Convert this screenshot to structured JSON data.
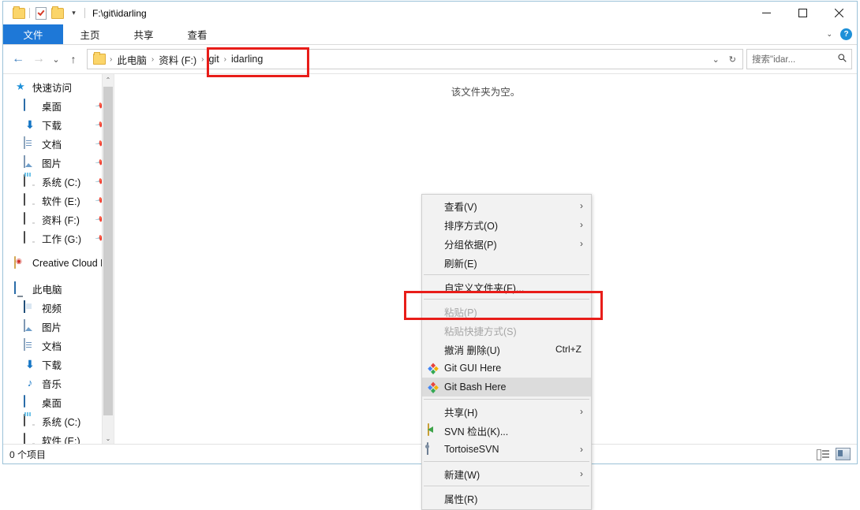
{
  "window": {
    "title": "F:\\git\\idarling",
    "quick_access": [
      {
        "name": "folder-icon",
        "label": ""
      },
      {
        "name": "properties-icon",
        "label": ""
      },
      {
        "name": "new-folder-icon",
        "label": ""
      },
      {
        "name": "customize-qat-chevron",
        "label": "▾"
      }
    ],
    "controls": {
      "minimize": "—",
      "maximize": "□",
      "close": "✕"
    }
  },
  "ribbon": {
    "tabs": [
      {
        "label": "文件",
        "active": true
      },
      {
        "label": "主页",
        "active": false
      },
      {
        "label": "共享",
        "active": false
      },
      {
        "label": "查看",
        "active": false
      }
    ],
    "collapse_chevron": "⌄",
    "help_label": "?"
  },
  "navigation": {
    "back": "←",
    "forward": "→",
    "recent": "⌄",
    "up": "↑",
    "breadcrumb": [
      {
        "label": "此电脑"
      },
      {
        "label": "资料 (F:)"
      },
      {
        "label": "git"
      },
      {
        "label": "idarling"
      }
    ],
    "separator": "›",
    "dropdown": "⌄",
    "refresh": "↻"
  },
  "search": {
    "placeholder": "搜索\"idar...",
    "icon": "search-icon"
  },
  "sidebar": {
    "groups": [
      {
        "header": {
          "label": "快速访问",
          "icon": "star-icon"
        },
        "items": [
          {
            "label": "桌面",
            "icon": "desktop-icon",
            "pinned": true
          },
          {
            "label": "下载",
            "icon": "download-icon",
            "pinned": true
          },
          {
            "label": "文档",
            "icon": "documents-icon",
            "pinned": true
          },
          {
            "label": "图片",
            "icon": "pictures-icon",
            "pinned": true
          },
          {
            "label": "系统 (C:)",
            "icon": "system-drive-icon",
            "pinned": true
          },
          {
            "label": "软件 (E:)",
            "icon": "drive-icon",
            "pinned": true
          },
          {
            "label": "资料 (F:)",
            "icon": "drive-icon",
            "pinned": true
          },
          {
            "label": "工作 (G:)",
            "icon": "drive-icon",
            "pinned": true
          }
        ]
      },
      {
        "header": {
          "label": "Creative Cloud F",
          "icon": "creative-cloud-icon"
        },
        "items": []
      },
      {
        "header": {
          "label": "此电脑",
          "icon": "this-pc-icon"
        },
        "items": [
          {
            "label": "视频",
            "icon": "videos-icon",
            "pinned": false
          },
          {
            "label": "图片",
            "icon": "pictures-icon",
            "pinned": false
          },
          {
            "label": "文档",
            "icon": "documents-icon",
            "pinned": false
          },
          {
            "label": "下载",
            "icon": "download-icon",
            "pinned": false
          },
          {
            "label": "音乐",
            "icon": "music-icon",
            "pinned": false
          },
          {
            "label": "桌面",
            "icon": "desktop-icon",
            "pinned": false
          },
          {
            "label": "系统 (C:)",
            "icon": "system-drive-icon",
            "pinned": false
          },
          {
            "label": "软件 (E:)",
            "icon": "drive-icon",
            "pinned": false
          }
        ]
      }
    ],
    "scroll_up": "⌃",
    "scroll_down": "⌄"
  },
  "content": {
    "empty_message": "该文件夹为空。"
  },
  "context_menu": {
    "items": [
      {
        "label": "查看(V)",
        "icon": null,
        "submenu": true,
        "accel": "",
        "disabled": false,
        "highlighted": false
      },
      {
        "label": "排序方式(O)",
        "icon": null,
        "submenu": true,
        "accel": "",
        "disabled": false,
        "highlighted": false
      },
      {
        "label": "分组依据(P)",
        "icon": null,
        "submenu": true,
        "accel": "",
        "disabled": false,
        "highlighted": false
      },
      {
        "label": "刷新(E)",
        "icon": null,
        "submenu": false,
        "accel": "",
        "disabled": false,
        "highlighted": false
      },
      {
        "separator": true
      },
      {
        "label": "自定义文件夹(F)...",
        "icon": null,
        "submenu": false,
        "accel": "",
        "disabled": false,
        "highlighted": false
      },
      {
        "separator": true
      },
      {
        "label": "粘贴(P)",
        "icon": null,
        "submenu": false,
        "accel": "",
        "disabled": true,
        "highlighted": false
      },
      {
        "label": "粘贴快捷方式(S)",
        "icon": null,
        "submenu": false,
        "accel": "",
        "disabled": true,
        "highlighted": false
      },
      {
        "label": "撤消 删除(U)",
        "icon": null,
        "submenu": false,
        "accel": "Ctrl+Z",
        "disabled": false,
        "highlighted": false
      },
      {
        "label": "Git GUI Here",
        "icon": "git-icon",
        "submenu": false,
        "accel": "",
        "disabled": false,
        "highlighted": false
      },
      {
        "label": "Git Bash Here",
        "icon": "git-icon",
        "submenu": false,
        "accel": "",
        "disabled": false,
        "highlighted": true
      },
      {
        "separator": true
      },
      {
        "label": "共享(H)",
        "icon": null,
        "submenu": true,
        "accel": "",
        "disabled": false,
        "highlighted": false
      },
      {
        "label": "SVN 检出(K)...",
        "icon": "svn-icon",
        "submenu": false,
        "accel": "",
        "disabled": false,
        "highlighted": false
      },
      {
        "label": "TortoiseSVN",
        "icon": "tortoise-svn-icon",
        "submenu": true,
        "accel": "",
        "disabled": false,
        "highlighted": false
      },
      {
        "separator": true
      },
      {
        "label": "新建(W)",
        "icon": null,
        "submenu": true,
        "accel": "",
        "disabled": false,
        "highlighted": false
      },
      {
        "separator": true
      },
      {
        "label": "属性(R)",
        "icon": null,
        "submenu": false,
        "accel": "",
        "disabled": false,
        "highlighted": false
      }
    ],
    "submenu_arrow": "›"
  },
  "annotations": {
    "color": "#e81d19",
    "boxes": [
      {
        "name": "path-highlight",
        "target": "git > idarling"
      },
      {
        "name": "git-bash-highlight",
        "target": "Git Bash Here"
      }
    ]
  },
  "statusbar": {
    "item_count": "0 个项目",
    "view_details_icon": "details-view-icon",
    "view_tiles_icon": "tiles-view-icon"
  }
}
